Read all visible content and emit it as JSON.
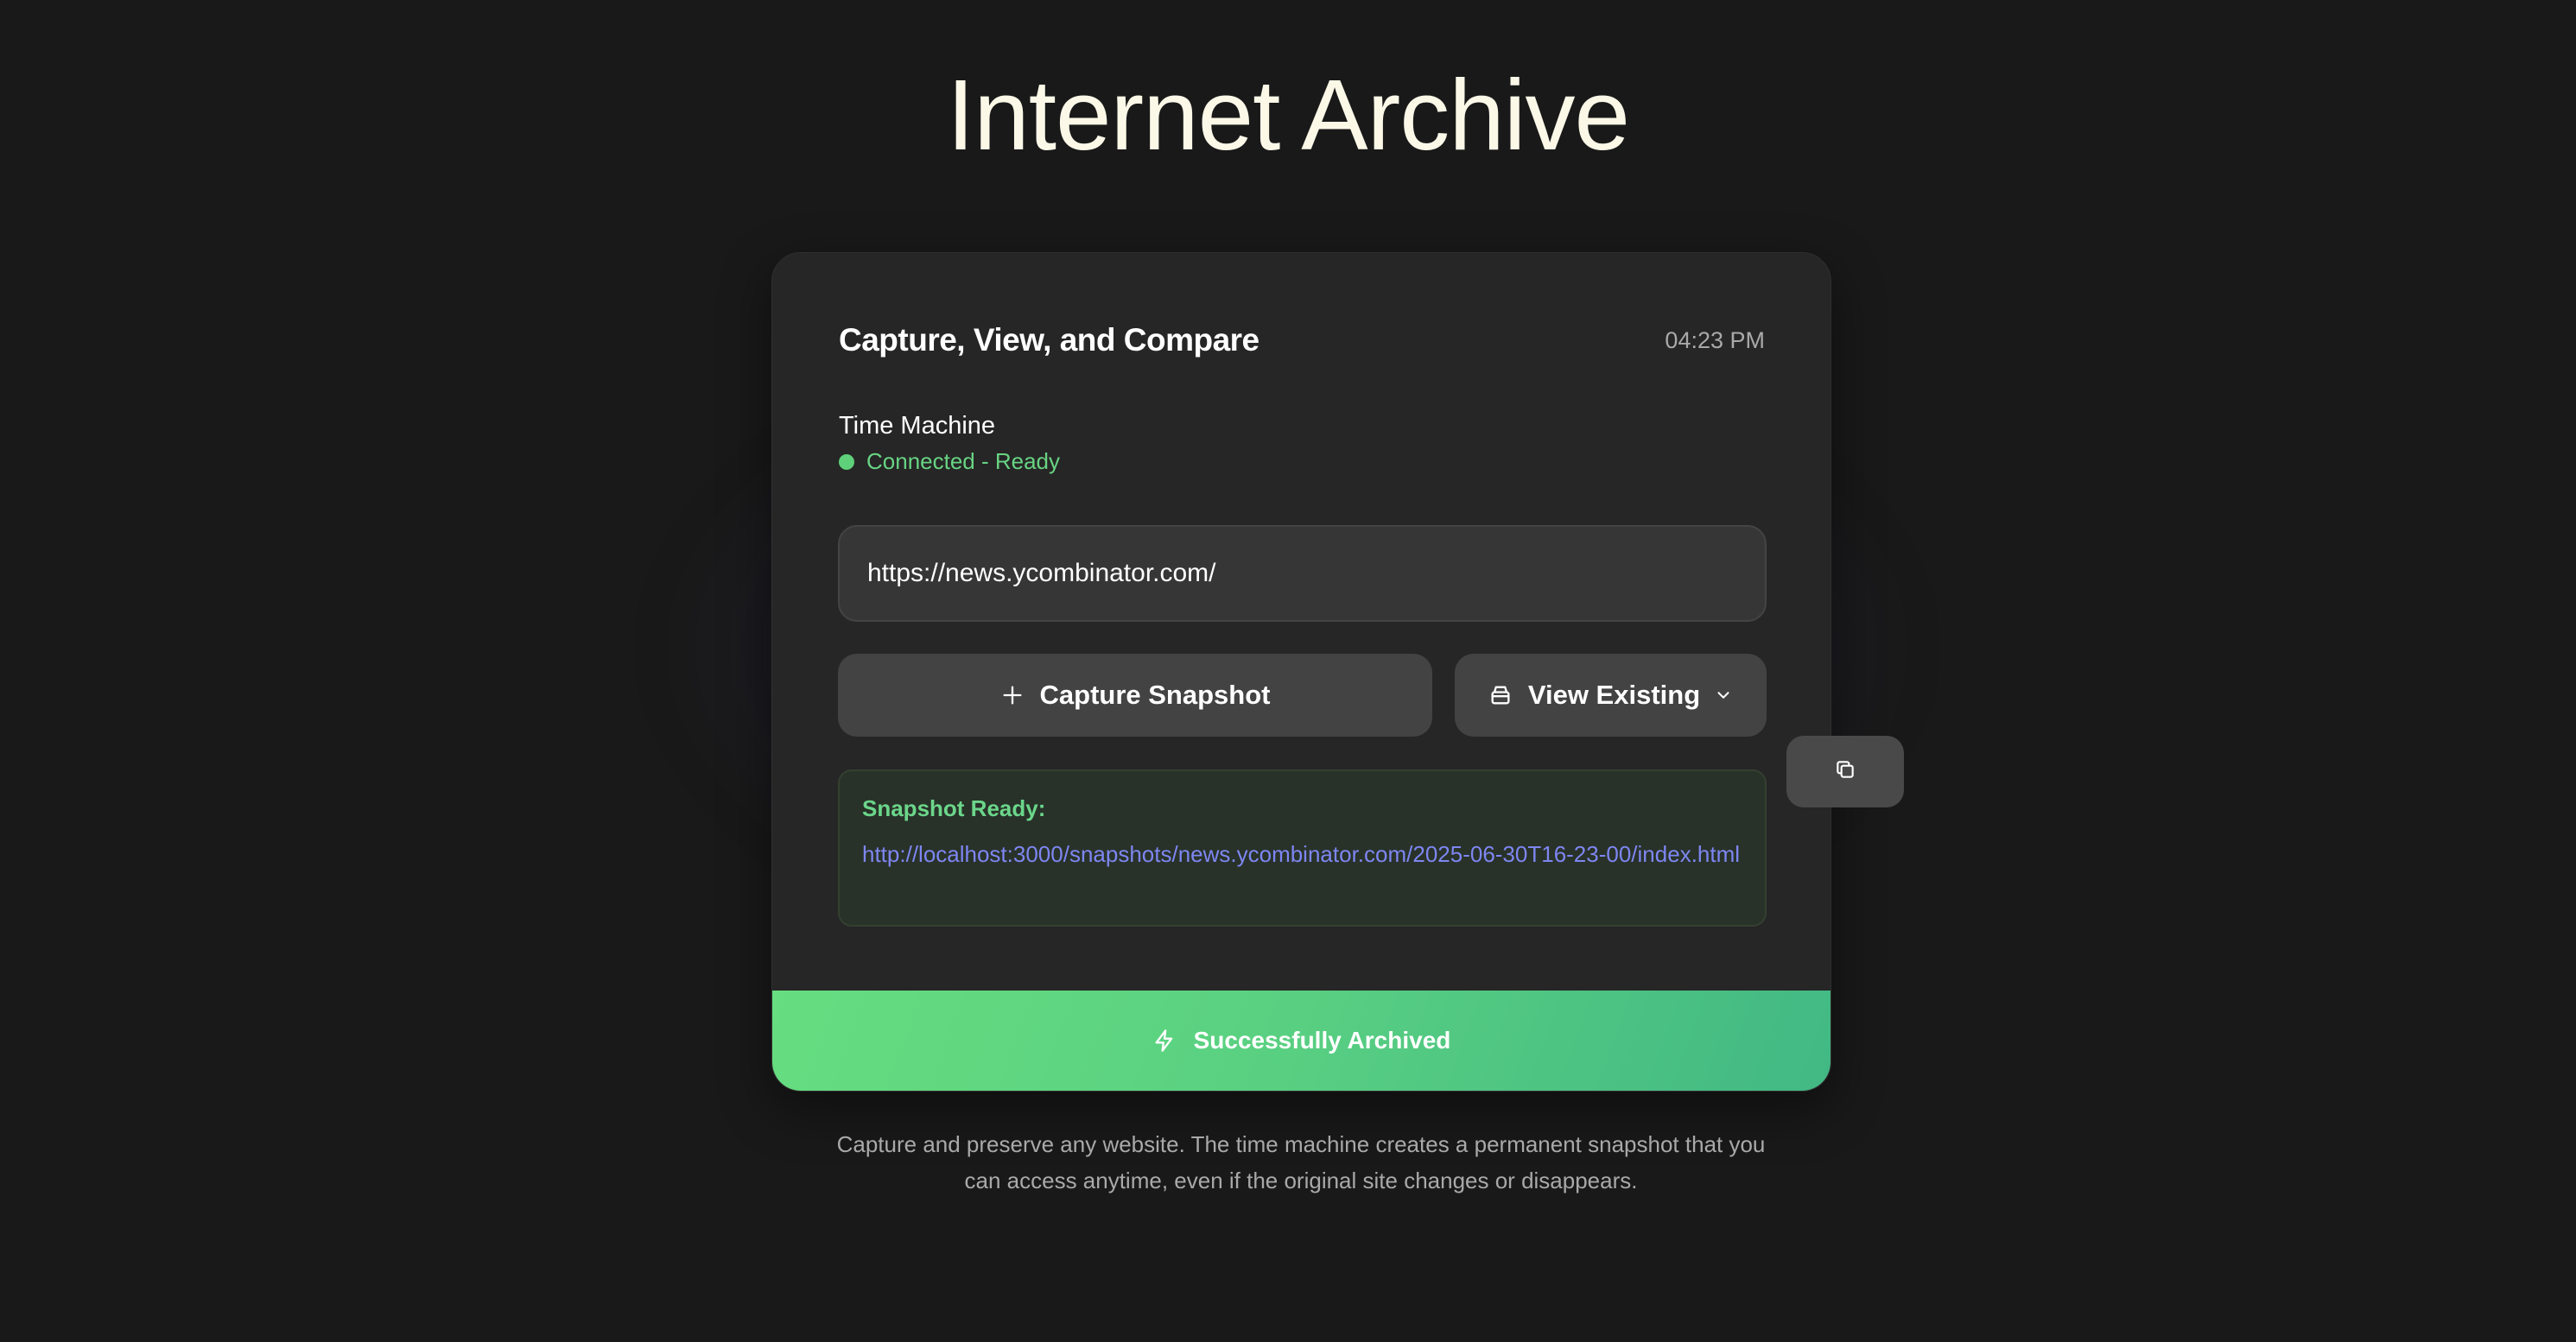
{
  "header": {
    "title": "Internet Archive"
  },
  "card": {
    "title": "Capture, View, and Compare",
    "time": "04:23 PM",
    "time_machine_label": "Time Machine",
    "status": {
      "text": "Connected - Ready",
      "color": "#5fd07a"
    },
    "url_input": {
      "value": "https://news.ycombinator.com/",
      "placeholder": ""
    },
    "buttons": {
      "capture_label": "Capture Snapshot",
      "capture_icon": "plus-icon",
      "view_label": "View Existing",
      "view_icon": "archive-box-icon",
      "view_chevron": "chevron-down-icon"
    },
    "snapshot": {
      "label": "Snapshot Ready:",
      "url": "http://localhost:3000/snapshots/news.ycombinator.com/2025-06-30T16-23-00/index.html"
    },
    "banner": {
      "text": "Successfully Archived",
      "icon": "lightning-icon"
    }
  },
  "copy_button": {
    "icon": "copy-icon"
  },
  "footer": {
    "description": "Capture and preserve any website. The time machine creates a permanent snapshot that you can access anytime, even if the original site changes or disappears."
  },
  "colors": {
    "background": "#191919",
    "card": "#262626",
    "accent_green": "#5fd07a",
    "link": "#7e86f2"
  }
}
